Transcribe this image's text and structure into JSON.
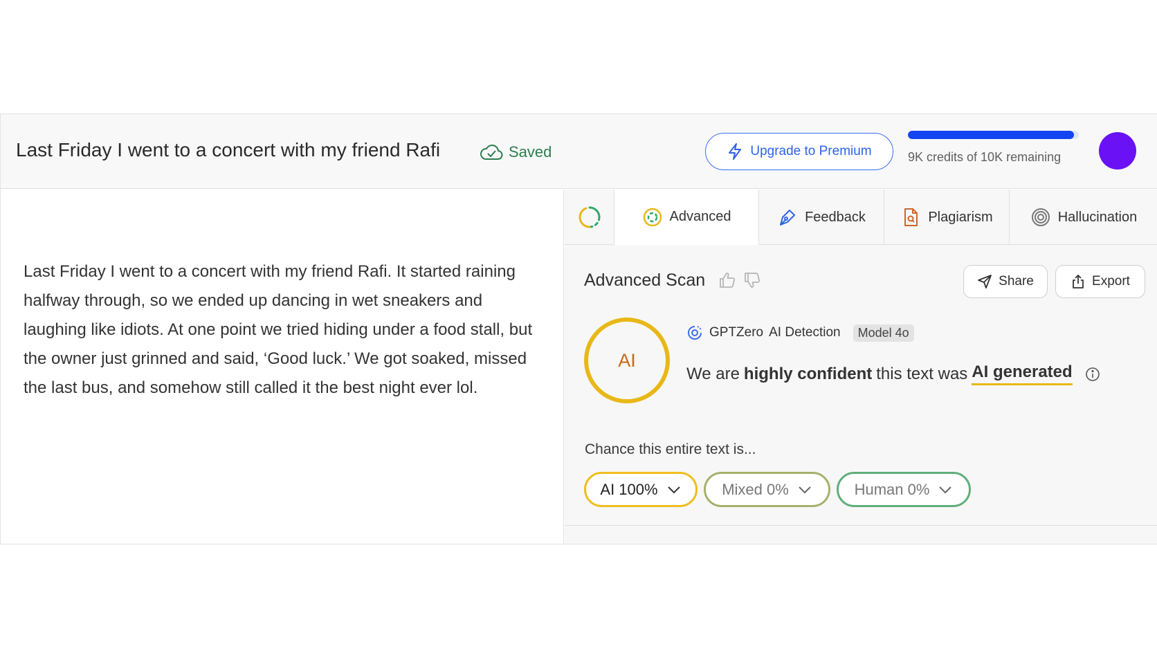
{
  "header": {
    "doc_title": "Last Friday I went to a concert with my friend Rafi",
    "saved_label": "Saved",
    "upgrade_label": "Upgrade to Premium",
    "credits_text": "9K credits of 10K remaining",
    "credits_fraction": 0.97,
    "avatar_color": "#6a12f5"
  },
  "editor": {
    "text": "Last Friday I went to a concert with my friend Rafi. It started raining halfway through, so we ended up dancing in wet sneakers and laughing like idiots. At one point we tried hiding under a food stall, but the owner just grinned and said, ‘Good luck.’ We got soaked, missed the last bus, and somehow still called it the best night ever lol."
  },
  "tabs": [
    {
      "label": "Advanced",
      "icon": "advanced-scan-icon",
      "active": true
    },
    {
      "label": "Feedback",
      "icon": "pen-icon",
      "active": false
    },
    {
      "label": "Plagiarism",
      "icon": "document-search-icon",
      "active": false
    },
    {
      "label": "Hallucination",
      "icon": "spiral-icon",
      "active": false
    }
  ],
  "scan": {
    "title": "Advanced Scan",
    "share_label": "Share",
    "export_label": "Export",
    "badge_text": "AI",
    "detector_name": "GPTZero",
    "detector_suffix": "AI Detection",
    "model_label": "Model 4o",
    "verdict_prefix": "We are",
    "verdict_strength": "highly confident",
    "verdict_middle": "this text was",
    "verdict_result": "AI generated",
    "chance_label": "Chance this entire text is...",
    "pills": [
      {
        "label": "AI 100%",
        "color": "#f0bd1b"
      },
      {
        "label": "Mixed 0%",
        "color": "#a6b06b"
      },
      {
        "label": "Human 0%",
        "color": "#5fae7a"
      }
    ]
  },
  "colors": {
    "accent_blue": "#2f63e6",
    "ai_yellow": "#e8b818",
    "saved_green": "#2e7d4f"
  }
}
